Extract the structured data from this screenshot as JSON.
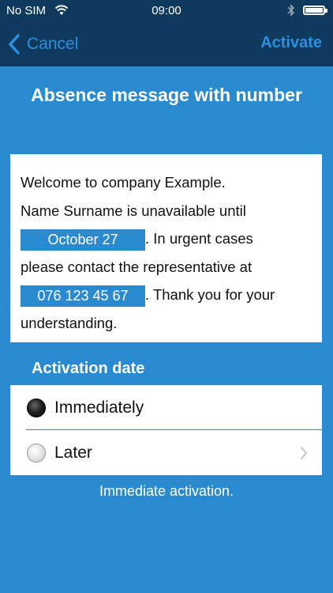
{
  "status_bar": {
    "carrier": "No SIM",
    "time": "09:00",
    "icons": [
      "wifi-icon",
      "bluetooth-icon",
      "battery-icon"
    ]
  },
  "nav": {
    "cancel_label": "Cancel",
    "activate_label": "Activate",
    "back_icon": "chevron-left-icon"
  },
  "title": "Absence message with number",
  "message": {
    "line1": "Welcome to company Example.",
    "line2": "Name Surname is unavailable until",
    "date_value": "October 27",
    "after_date": ". In urgent cases",
    "line4": "please contact the representative at",
    "phone_value": "076 123 45 67",
    "after_phone": ". Thank you for your",
    "line6": "understanding."
  },
  "activation": {
    "header": "Activation date",
    "options": [
      {
        "label": "Immediately",
        "selected": true
      },
      {
        "label": "Later",
        "selected": false
      }
    ],
    "footnote": "Immediate activation."
  },
  "colors": {
    "background": "#2a8ad0",
    "navbar": "#0f3a5d",
    "accent": "#2b8fe0",
    "field": "#2a8ad0"
  }
}
